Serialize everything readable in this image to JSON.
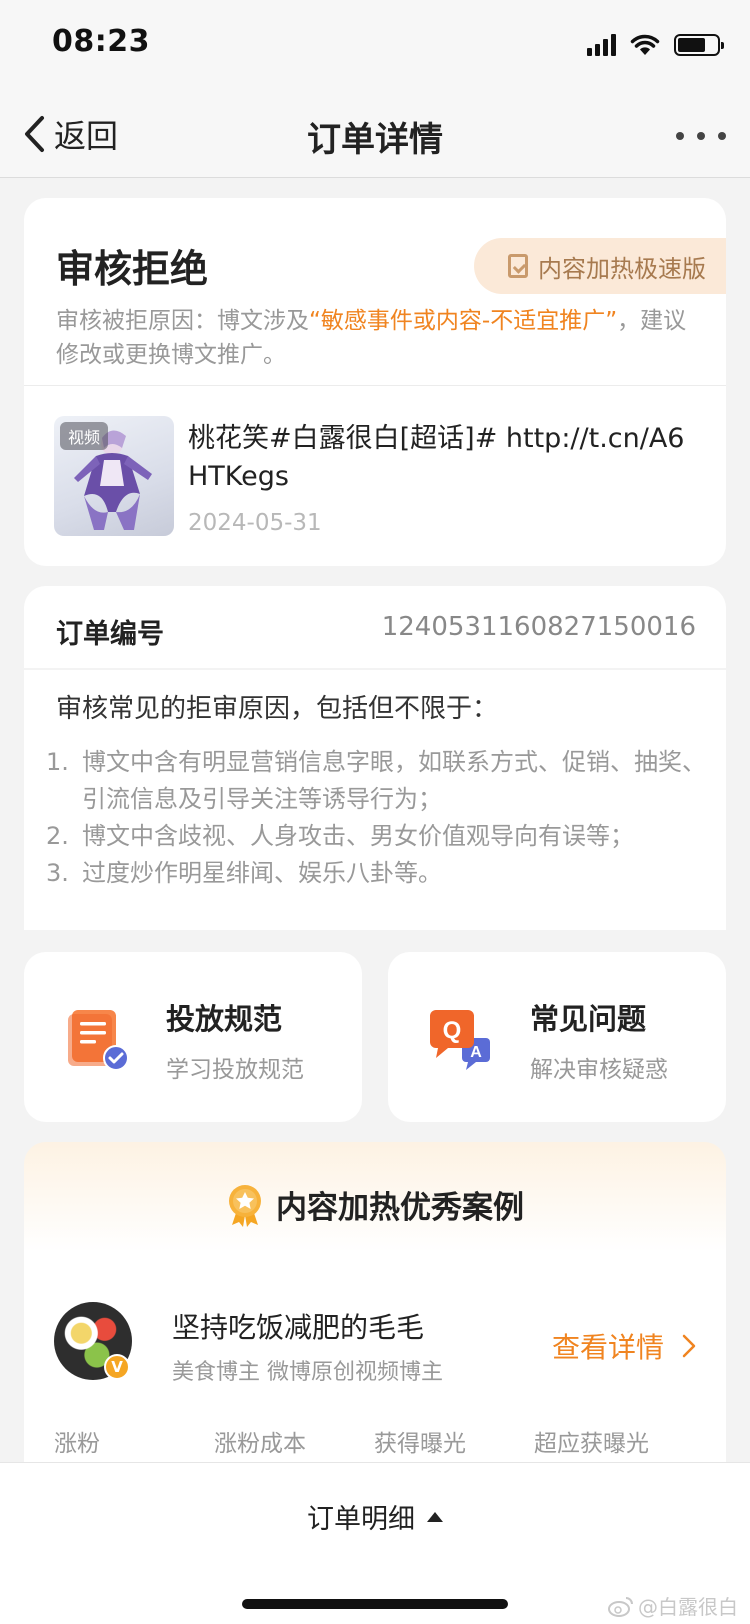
{
  "status_bar": {
    "time": "08:23"
  },
  "nav": {
    "back_label": "返回",
    "title": "订单详情"
  },
  "status_card": {
    "title": "审核拒绝",
    "badge_label": "内容加热极速版",
    "reason_prefix": "审核被拒原因：博文涉及",
    "reason_highlight": "“敏感事件或内容-不适宜推广”",
    "reason_suffix": "，建议修改或更换博文推广。",
    "thumb_tag": "视频",
    "post_text": "桃花笑#白露很白[超话]# http://t.cn/A6HTKegs",
    "post_date": "2024-05-31"
  },
  "order": {
    "label": "订单编号",
    "value": "1240531160827150016"
  },
  "reasons": {
    "title": "审核常见的拒审原因，包括但不限于：",
    "items": [
      {
        "num": "1.",
        "text": "博文中含有明显营销信息字眼，如联系方式、促销、抽奖、引流信息及引导关注等诱导行为；"
      },
      {
        "num": "2.",
        "text": "博文中含歧视、人身攻击、男女价值观导向有误等；"
      },
      {
        "num": "3.",
        "text": "过度炒作明星绯闻、娱乐八卦等。"
      }
    ]
  },
  "tiles": [
    {
      "title": "投放规范",
      "subtitle": "学习投放规范",
      "icon": "document-check-icon"
    },
    {
      "title": "常见问题",
      "subtitle": "解决审核疑惑",
      "icon": "qa-icon"
    }
  ],
  "cases": {
    "title": "内容加热优秀案例",
    "case": {
      "name": "坚持吃饭减肥的毛毛",
      "tags": "美食博主 微博原创视频博主",
      "link_label": "查看详情",
      "verified_mark": "V"
    },
    "stats": [
      "涨粉",
      "涨粉成本",
      "获得曝光",
      "超应获曝光"
    ]
  },
  "bottom": {
    "label": "订单明细",
    "watermark": "@白露很白"
  },
  "colors": {
    "accent": "#f08420",
    "badge_bg": "#fbe9d8",
    "badge_text": "#a77a4f"
  }
}
